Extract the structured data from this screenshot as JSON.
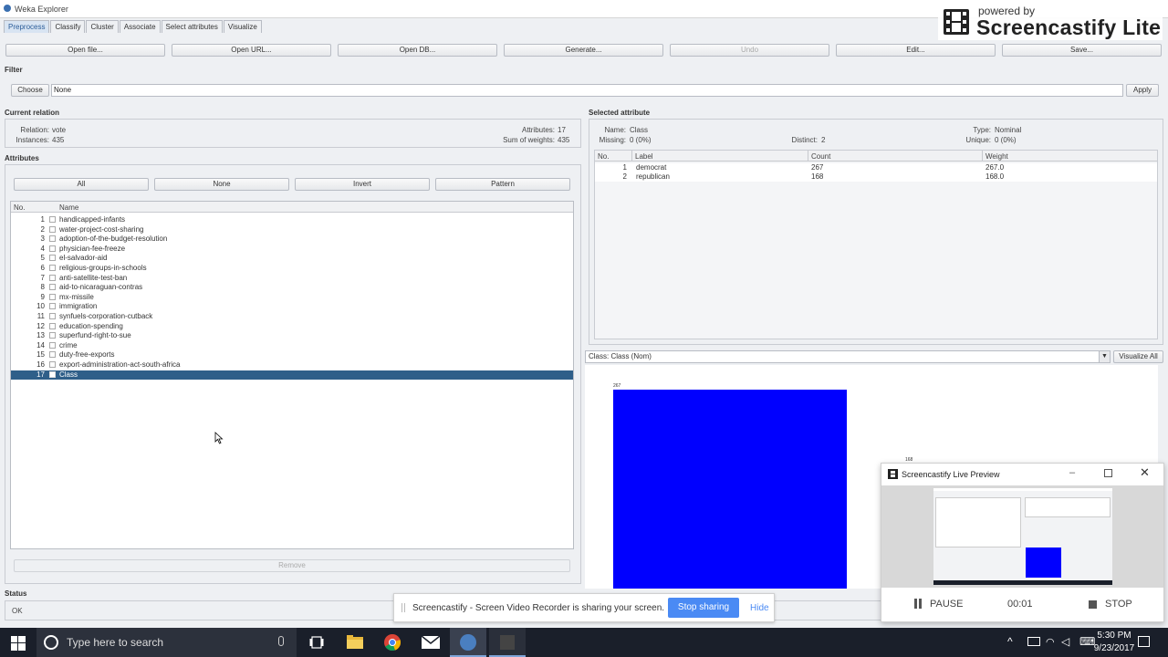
{
  "window": {
    "title": "Weka Explorer"
  },
  "tabs": [
    "Preprocess",
    "Classify",
    "Cluster",
    "Associate",
    "Select attributes",
    "Visualize"
  ],
  "toolbar": {
    "open_file": "Open file...",
    "open_url": "Open URL...",
    "open_db": "Open DB...",
    "generate": "Generate...",
    "undo": "Undo",
    "edit": "Edit...",
    "save": "Save..."
  },
  "filter": {
    "section": "Filter",
    "choose": "Choose",
    "value": "None",
    "apply": "Apply"
  },
  "current_relation": {
    "section": "Current relation",
    "relation_label": "Relation:",
    "relation": "vote",
    "instances_label": "Instances:",
    "instances": "435",
    "attributes_label": "Attributes:",
    "attributes": "17",
    "sum_weights_label": "Sum of weights:",
    "sum_weights": "435"
  },
  "attributes": {
    "section": "Attributes",
    "btn_all": "All",
    "btn_none": "None",
    "btn_invert": "Invert",
    "btn_pattern": "Pattern",
    "col_no": "No.",
    "col_name": "Name",
    "rows": [
      {
        "no": "1",
        "name": "handicapped-infants"
      },
      {
        "no": "2",
        "name": "water-project-cost-sharing"
      },
      {
        "no": "3",
        "name": "adoption-of-the-budget-resolution"
      },
      {
        "no": "4",
        "name": "physician-fee-freeze"
      },
      {
        "no": "5",
        "name": "el-salvador-aid"
      },
      {
        "no": "6",
        "name": "religious-groups-in-schools"
      },
      {
        "no": "7",
        "name": "anti-satellite-test-ban"
      },
      {
        "no": "8",
        "name": "aid-to-nicaraguan-contras"
      },
      {
        "no": "9",
        "name": "mx-missile"
      },
      {
        "no": "10",
        "name": "immigration"
      },
      {
        "no": "11",
        "name": "synfuels-corporation-cutback"
      },
      {
        "no": "12",
        "name": "education-spending"
      },
      {
        "no": "13",
        "name": "superfund-right-to-sue"
      },
      {
        "no": "14",
        "name": "crime"
      },
      {
        "no": "15",
        "name": "duty-free-exports"
      },
      {
        "no": "16",
        "name": "export-administration-act-south-africa"
      },
      {
        "no": "17",
        "name": "Class"
      }
    ],
    "remove": "Remove"
  },
  "selected_attribute": {
    "section": "Selected attribute",
    "name_label": "Name:",
    "name": "Class",
    "missing_label": "Missing:",
    "missing": "0 (0%)",
    "distinct_label": "Distinct:",
    "distinct": "2",
    "type_label": "Type:",
    "type": "Nominal",
    "unique_label": "Unique:",
    "unique": "0 (0%)",
    "col_no": "No.",
    "col_label": "Label",
    "col_count": "Count",
    "col_weight": "Weight",
    "rows": [
      {
        "no": "1",
        "label": "democrat",
        "count": "267",
        "weight": "267.0"
      },
      {
        "no": "2",
        "label": "republican",
        "count": "168",
        "weight": "168.0"
      }
    ]
  },
  "visualize": {
    "class_select": "Class: Class (Nom)",
    "visualize_all": "Visualize All",
    "bar_label_democrat": "267",
    "bar_label_republican": "168",
    "democrat_color": "#0000ff"
  },
  "status": {
    "section": "Status",
    "text": "OK"
  },
  "screencastify": {
    "powered_by": "powered by",
    "brand": "Screencastify Lite",
    "preview_title": "Screencastify Live Preview",
    "pause": "PAUSE",
    "timer": "00:01",
    "stop": "STOP",
    "share_text": "Screencastify - Screen Video Recorder is sharing your screen.",
    "stop_sharing": "Stop sharing",
    "hide": "Hide"
  },
  "taskbar": {
    "search_placeholder": "Type here to search",
    "time": "5:30 PM",
    "date": "9/23/2017"
  }
}
